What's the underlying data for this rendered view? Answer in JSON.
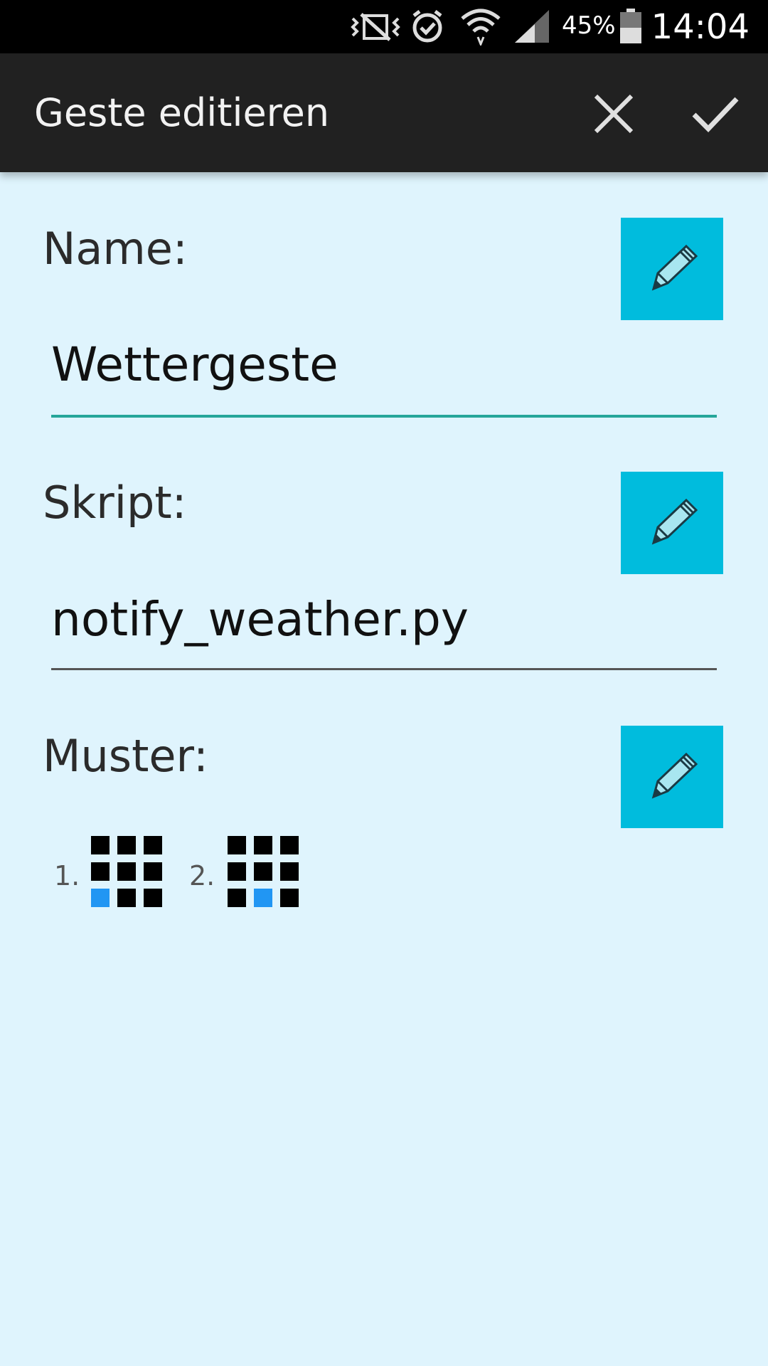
{
  "status_bar": {
    "battery_percent": "45%",
    "time": "14:04",
    "icons": [
      "vibrate-mute-icon",
      "alarm-icon",
      "wifi-icon",
      "signal-icon",
      "battery-icon"
    ]
  },
  "app_bar": {
    "title": "Geste editieren",
    "close_icon": "close-icon",
    "confirm_icon": "check-icon"
  },
  "form": {
    "name": {
      "label": "Name:",
      "value": "Wettergeste",
      "edit_icon": "pencil-icon"
    },
    "script": {
      "label": "Skript:",
      "value": "notify_weather.py",
      "edit_icon": "pencil-icon"
    },
    "pattern": {
      "label": "Muster:",
      "edit_icon": "pencil-icon",
      "steps": [
        {
          "number": "1.",
          "active_cell": [
            2,
            0
          ]
        },
        {
          "number": "2.",
          "active_cell": [
            2,
            1
          ]
        }
      ]
    }
  },
  "colors": {
    "background": "#dff4fd",
    "app_bar": "#212121",
    "edit_button": "#00bcdd",
    "active_underline": "#26a69a",
    "pattern_active": "#2196f3"
  }
}
